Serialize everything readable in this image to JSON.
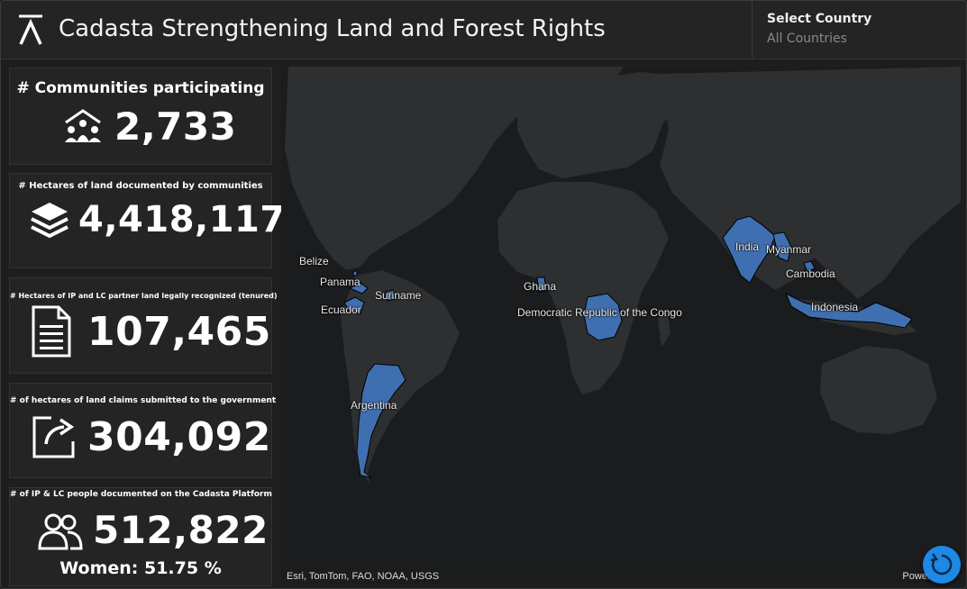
{
  "header": {
    "title": "Cadasta Strengthening Land and Forest Rights",
    "selector_label": "Select Country",
    "selector_value": "All Countries"
  },
  "cards": [
    {
      "title": "# Communities participating",
      "value": "2,733",
      "icon": "community-icon"
    },
    {
      "title": "# Hectares of land documented by communities",
      "value": "4,418,117",
      "icon": "layers-icon"
    },
    {
      "title": "# Hectares of IP and LC partner land legally recognized (tenured)",
      "value": "107,465",
      "icon": "document-icon"
    },
    {
      "title": "# of hectares of land claims submitted to the government",
      "value": "304,092",
      "icon": "share-icon"
    },
    {
      "title": "# of IP & LC people documented on the Cadasta Platform",
      "value": "512,822",
      "icon": "people-icon",
      "extra": "Women: 51.75 %"
    }
  ],
  "map": {
    "labels": [
      "Belize",
      "Panama",
      "Ecuador",
      "Suriname",
      "Ghana",
      "Democratic Republic of the Congo",
      "India",
      "Myanmar",
      "Cambodia",
      "Indonesia",
      "Argentina"
    ],
    "attribution": "Esri, TomTom, FAO, NOAA, USGS",
    "powered": "Powered b"
  },
  "colors": {
    "highlight": "#3f6fb0",
    "land": "#2d2f31",
    "ocean": "#1a1c1e",
    "fab": "#1e88e5"
  }
}
